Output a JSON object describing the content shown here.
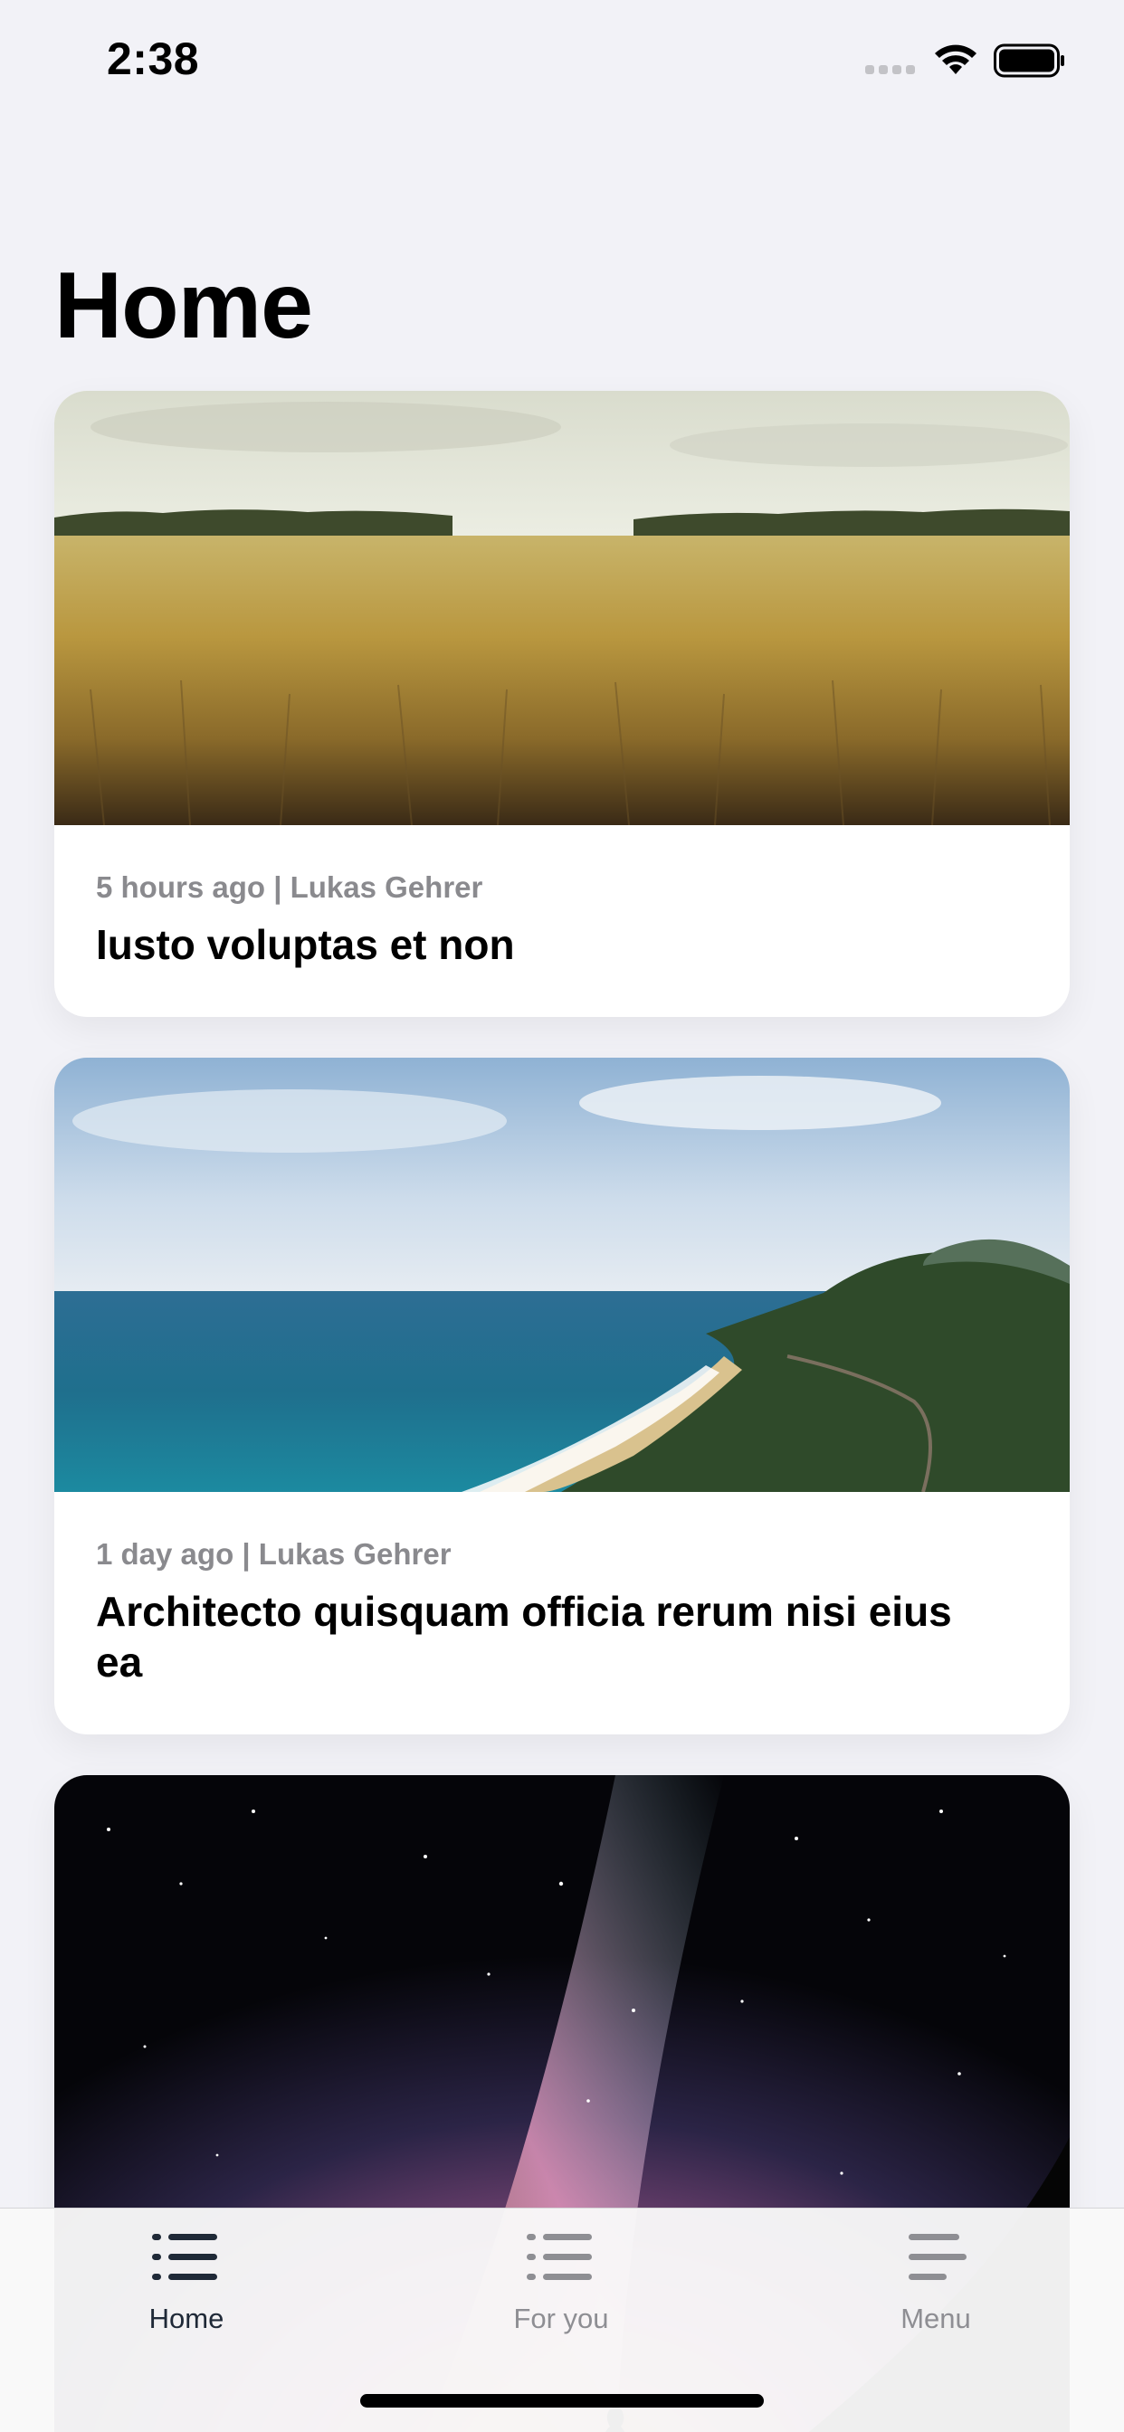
{
  "status_bar": {
    "time": "2:38"
  },
  "page": {
    "title": "Home"
  },
  "cards": [
    {
      "meta": "5 hours ago | Lukas Gehrer",
      "title": "Iusto voluptas et non",
      "image": "wheat-field"
    },
    {
      "meta": "1 day ago | Lukas Gehrer",
      "title": "Architecto quisquam officia rerum nisi eius ea",
      "image": "coastline"
    },
    {
      "meta": "",
      "title": "",
      "image": "milky-way"
    }
  ],
  "tab_bar": {
    "tabs": [
      {
        "label": "Home",
        "icon": "list-icon",
        "active": true
      },
      {
        "label": "For you",
        "icon": "list-icon",
        "active": false
      },
      {
        "label": "Menu",
        "icon": "menu-icon",
        "active": false
      }
    ]
  },
  "colors": {
    "background": "#f2f2f7",
    "active_tab": "#1f2937",
    "inactive_tab": "#8e8e93"
  }
}
